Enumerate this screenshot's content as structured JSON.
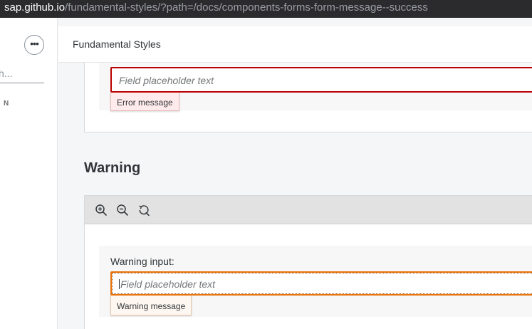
{
  "browser": {
    "url_host": "sap.github.io",
    "url_path": "/fundamental-styles/?path=/docs/components-forms-form-message--success"
  },
  "sidebar": {
    "more_label": "•••",
    "search_placeholder": "h...",
    "section_label": "N"
  },
  "header": {
    "title": "Fundamental Styles"
  },
  "error_example": {
    "placeholder": "Field placeholder text",
    "message": "Error message"
  },
  "warning_section": {
    "heading": "Warning",
    "toolbar": {
      "zoom_in_icon": "zoom-in-icon",
      "zoom_out_icon": "zoom-out-icon",
      "reset_icon": "reset-zoom-icon"
    },
    "label": "Warning input:",
    "placeholder": "Field placeholder text",
    "message": "Warning message"
  },
  "colors": {
    "error_border": "#bb0000",
    "warning_border": "#e9730c",
    "error_bg": "#ffebeb",
    "warning_bg": "#fef7f1"
  }
}
